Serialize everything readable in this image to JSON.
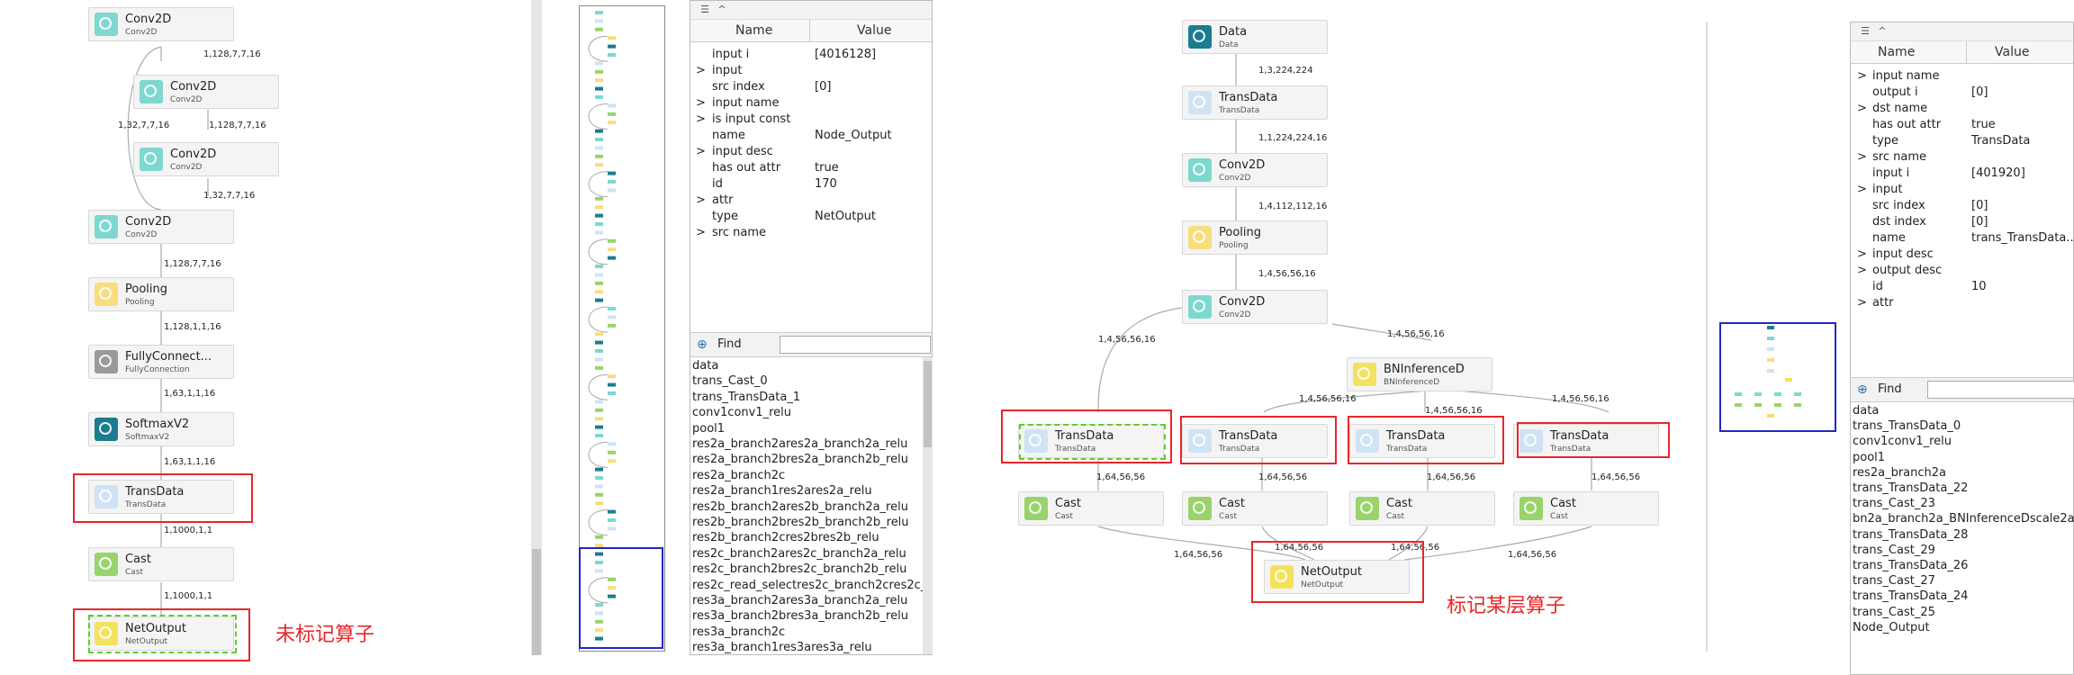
{
  "colors": {
    "conv": "#7dd8cf",
    "pool": "#f7dd7d",
    "fc": "#9a9a9a",
    "softmax": "#1b7c8f",
    "trans": "#cfe3f5",
    "cast": "#98d36b",
    "netout": "#f3e25e",
    "data": "#1b7c8f",
    "bn": "#f3e25e",
    "highlight_red": "#e8262a",
    "highlight_green": "#5ad02a",
    "highlight_blue": "#2227c9"
  },
  "left_graph": {
    "nodes": [
      {
        "name": "Conv2D",
        "type": "Conv2D"
      },
      {
        "name": "Conv2D",
        "type": "Conv2D"
      },
      {
        "name": "Conv2D",
        "type": "Conv2D"
      },
      {
        "name": "Conv2D",
        "type": "Conv2D"
      },
      {
        "name": "Pooling",
        "type": "Pooling"
      },
      {
        "name": "FullyConnect...",
        "type": "FullyConnection"
      },
      {
        "name": "SoftmaxV2",
        "type": "SoftmaxV2"
      },
      {
        "name": "TransData",
        "type": "TransData"
      },
      {
        "name": "Cast",
        "type": "Cast"
      },
      {
        "name": "NetOutput",
        "type": "NetOutput"
      }
    ],
    "edges": [
      "1,128,7,7,16",
      "1,32,7,7,16",
      "1,128,7,7,16",
      "1,32,7,7,16",
      "1,128,7,7,16",
      "1,128,1,1,16",
      "1,63,1,1,16",
      "1,63,1,1,16",
      "1,1000,1,1",
      "1,1000,1,1"
    ],
    "annotation": "未标记算子"
  },
  "left_props": {
    "col_name": "Name",
    "col_value": "Value",
    "rows": [
      {
        "expand": "",
        "name": "input i",
        "value": "[4016128]"
      },
      {
        "expand": ">",
        "name": "input",
        "value": ""
      },
      {
        "expand": "",
        "name": "src index",
        "value": "[0]"
      },
      {
        "expand": ">",
        "name": "input name",
        "value": ""
      },
      {
        "expand": ">",
        "name": "is input const",
        "value": ""
      },
      {
        "expand": "",
        "name": "name",
        "value": "Node_Output"
      },
      {
        "expand": ">",
        "name": "input desc",
        "value": ""
      },
      {
        "expand": "",
        "name": "has out attr",
        "value": "true"
      },
      {
        "expand": "",
        "name": "id",
        "value": "170"
      },
      {
        "expand": ">",
        "name": "attr",
        "value": ""
      },
      {
        "expand": "",
        "name": "type",
        "value": "NetOutput"
      },
      {
        "expand": ">",
        "name": "src name",
        "value": ""
      }
    ],
    "find_label": "Find",
    "find_value": "",
    "list": [
      "data",
      "trans_Cast_0",
      "trans_TransData_1",
      "conv1conv1_relu",
      "pool1",
      "res2a_branch2ares2a_branch2a_relu",
      "res2a_branch2bres2a_branch2b_relu",
      "res2a_branch2c",
      "res2a_branch1res2ares2a_relu",
      "res2b_branch2ares2b_branch2a_relu",
      "res2b_branch2bres2b_branch2b_relu",
      "res2b_branch2cres2bres2b_relu",
      "res2c_branch2ares2c_branch2a_relu",
      "res2c_branch2bres2c_branch2b_relu",
      "res2c_read_selectres2c_branch2cres2c_relu",
      "res3a_branch2ares3a_branch2a_relu",
      "res3a_branch2bres3a_branch2b_relu",
      "res3a_branch2c",
      "res3a_branch1res3ares3a_relu"
    ]
  },
  "right_graph": {
    "nodes": [
      {
        "name": "Data",
        "type": "Data"
      },
      {
        "name": "TransData",
        "type": "TransData"
      },
      {
        "name": "Conv2D",
        "type": "Conv2D"
      },
      {
        "name": "Pooling",
        "type": "Pooling"
      },
      {
        "name": "Conv2D",
        "type": "Conv2D"
      },
      {
        "name": "BNInferenceD",
        "type": "BNInferenceD"
      },
      {
        "name": "TransData",
        "type": "TransData"
      },
      {
        "name": "TransData",
        "type": "TransData"
      },
      {
        "name": "TransData",
        "type": "TransData"
      },
      {
        "name": "TransData",
        "type": "TransData"
      },
      {
        "name": "Cast",
        "type": "Cast"
      },
      {
        "name": "Cast",
        "type": "Cast"
      },
      {
        "name": "Cast",
        "type": "Cast"
      },
      {
        "name": "Cast",
        "type": "Cast"
      },
      {
        "name": "NetOutput",
        "type": "NetOutput"
      }
    ],
    "edges": [
      "1,3,224,224",
      "1,1,224,224,16",
      "1,4,112,112,16",
      "1,4,56,56,16",
      "1,4,56,56,16",
      "1,4,56,56,16",
      "1,4,56,56,16",
      "1,4,56,56,16",
      "1,4,56,56,16",
      "1,64,56,56",
      "1,64,56,56",
      "1,64,56,56",
      "1,64,56,56",
      "1,64,56,56",
      "1,64,56,56",
      "1,64,56,56",
      "1,64,56,56"
    ],
    "annotation": "标记某层算子"
  },
  "right_props": {
    "col_name": "Name",
    "col_value": "Value",
    "rows": [
      {
        "expand": ">",
        "name": "input name",
        "value": ""
      },
      {
        "expand": "",
        "name": "output i",
        "value": "[0]"
      },
      {
        "expand": ">",
        "name": "dst name",
        "value": ""
      },
      {
        "expand": "",
        "name": "has out attr",
        "value": "true"
      },
      {
        "expand": "",
        "name": "type",
        "value": "TransData"
      },
      {
        "expand": ">",
        "name": "src name",
        "value": ""
      },
      {
        "expand": "",
        "name": "input i",
        "value": "[401920]"
      },
      {
        "expand": ">",
        "name": "input",
        "value": ""
      },
      {
        "expand": "",
        "name": "src index",
        "value": "[0]"
      },
      {
        "expand": "",
        "name": "dst index",
        "value": "[0]"
      },
      {
        "expand": "",
        "name": "name",
        "value": "trans_TransData..."
      },
      {
        "expand": ">",
        "name": "input desc",
        "value": ""
      },
      {
        "expand": ">",
        "name": "output desc",
        "value": ""
      },
      {
        "expand": "",
        "name": "id",
        "value": "10"
      },
      {
        "expand": ">",
        "name": "attr",
        "value": ""
      }
    ],
    "find_label": "Find",
    "find_value": "",
    "list": [
      "data",
      "trans_TransData_0",
      "conv1conv1_relu",
      "pool1",
      "res2a_branch2a",
      "trans_TransData_22",
      "trans_Cast_23",
      "bn2a_branch2a_BNInferenceDscale2a",
      "trans_TransData_28",
      "trans_Cast_29",
      "trans_TransData_26",
      "trans_Cast_27",
      "trans_TransData_24",
      "trans_Cast_25",
      "Node_Output"
    ]
  }
}
